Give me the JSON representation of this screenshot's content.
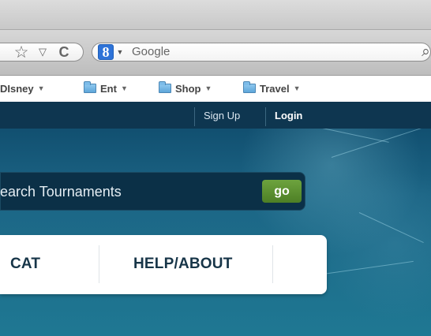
{
  "browser": {
    "search": {
      "engine": "Google",
      "placeholder": "Google",
      "button_icon": "search-icon"
    },
    "toolbar": {
      "star_icon": "star-icon",
      "history_icon": "triangle-down-icon",
      "refresh_icon": "refresh-icon"
    },
    "bookmarks": [
      {
        "label": "DIsney",
        "icon": "folder-icon"
      },
      {
        "label": "Ent",
        "icon": "folder-icon"
      },
      {
        "label": "Shop",
        "icon": "folder-icon"
      },
      {
        "label": "Travel",
        "icon": "folder-icon"
      }
    ]
  },
  "site": {
    "header": {
      "links": [
        "Sign Up",
        "Login"
      ]
    },
    "search": {
      "label": "earch Tournaments",
      "button": "go"
    },
    "menu": {
      "items": [
        "CAT",
        "HELP/ABOUT"
      ]
    }
  },
  "colors": {
    "page_blue": "#1c6585",
    "nav_bar": "#0e3650",
    "search_bar": "#0b3047",
    "go_button": "#5c9132",
    "menu_text": "#173548"
  }
}
